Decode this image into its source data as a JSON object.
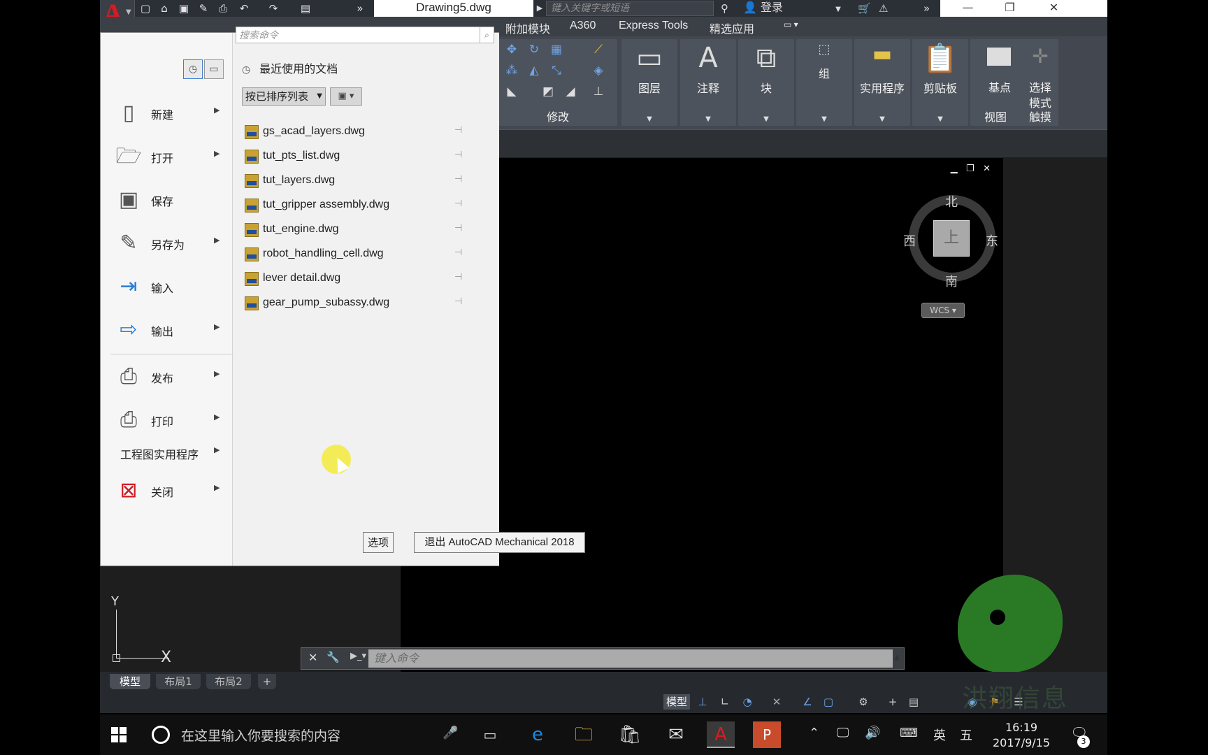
{
  "titlebar": {
    "document_title": "Drawing5.dwg",
    "keyword_placeholder": "键入关键字或短语",
    "login_label": "登录"
  },
  "ribbon": {
    "tabs": [
      "附加模块",
      "A360",
      "Express Tools",
      "精选应用"
    ],
    "panels": {
      "modify_label": "修改",
      "layers_label": "图层",
      "annotation_label": "注释",
      "block_label": "块",
      "group_label": "组",
      "utilities_label": "实用程序",
      "clipboard_label": "剪贴板",
      "basepoint_label": "基点",
      "select_mode_label_1": "选择",
      "select_mode_label_2": "模式",
      "view_label": "视图",
      "touch_label": "触摸"
    }
  },
  "app_menu": {
    "search_placeholder": "搜索命令",
    "items": [
      {
        "label": "新建",
        "icon": "new-file-icon",
        "has_arrow": true
      },
      {
        "label": "打开",
        "icon": "open-folder-icon",
        "has_arrow": true
      },
      {
        "label": "保存",
        "icon": "save-disk-icon",
        "has_arrow": false
      },
      {
        "label": "另存为",
        "icon": "save-as-icon",
        "has_arrow": true
      },
      {
        "label": "输入",
        "icon": "import-icon",
        "has_arrow": false
      },
      {
        "label": "输出",
        "icon": "export-icon",
        "has_arrow": true
      },
      {
        "label": "发布",
        "icon": "publish-icon",
        "has_arrow": true
      },
      {
        "label": "打印",
        "icon": "print-icon",
        "has_arrow": true
      },
      {
        "label": "工程图实用程序",
        "icon": "",
        "has_arrow": true
      },
      {
        "label": "关闭",
        "icon": "close-doc-icon",
        "has_arrow": true
      }
    ],
    "recent_title": "最近使用的文档",
    "sort_label": "按已排序列表",
    "recent_files": [
      "gs_acad_layers.dwg",
      "tut_pts_list.dwg",
      "tut_layers.dwg",
      "tut_gripper assembly.dwg",
      "tut_engine.dwg",
      "robot_handling_cell.dwg",
      "lever detail.dwg",
      "gear_pump_subassy.dwg"
    ],
    "options_label": "选项",
    "exit_label": "退出 AutoCAD Mechanical 2018"
  },
  "viewcube": {
    "north": "北",
    "south": "南",
    "east": "东",
    "west": "西",
    "top": "上",
    "wcs": "WCS"
  },
  "ucs": {
    "x": "X",
    "y": "Y"
  },
  "command_line": {
    "placeholder": "键入命令"
  },
  "layout_tabs": [
    "模型",
    "布局1",
    "布局2"
  ],
  "status": {
    "model_label": "模型"
  },
  "watermark": {
    "text": "洪翔信息"
  },
  "taskbar": {
    "search_text": "在这里输入你要搜索的内容",
    "ime_lang": "英",
    "ime_mode": "五",
    "time": "16:19",
    "date": "2017/9/15",
    "notif_count": "3"
  },
  "colors": {
    "brand": "#d21d24",
    "accent_blue": "#6ea6e8",
    "file_icon": "#c9a232"
  }
}
